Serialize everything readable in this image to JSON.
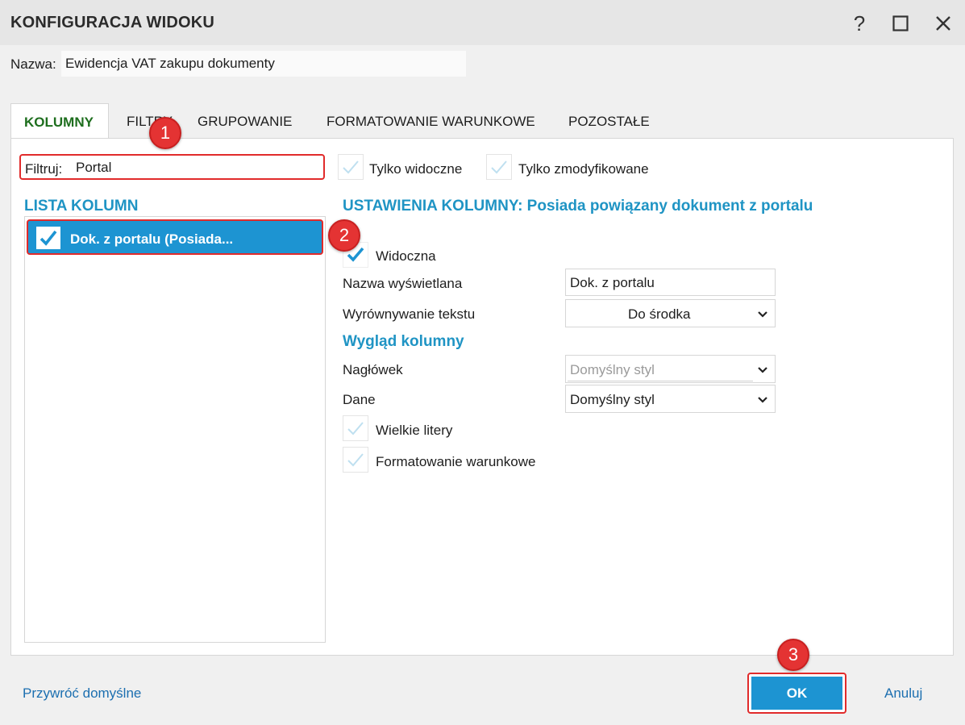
{
  "window": {
    "title": "KONFIGURACJA WIDOKU",
    "help_label": "?",
    "maximize_label": "☐",
    "close_label": "✕"
  },
  "name_field": {
    "label": "Nazwa:",
    "value": "Ewidencja VAT zakupu dokumenty"
  },
  "tabs": [
    {
      "label": "KOLUMNY",
      "active": true
    },
    {
      "label": "FILTRY",
      "active": false
    },
    {
      "label": "GRUPOWANIE",
      "active": false
    },
    {
      "label": "FORMATOWANIE WARUNKOWE",
      "active": false
    },
    {
      "label": "POZOSTAŁE",
      "active": false
    }
  ],
  "filter": {
    "label": "Filtruj:",
    "value": "Portal",
    "only_visible_label": "Tylko widoczne",
    "only_modified_label": "Tylko zmodyfikowane"
  },
  "column_list": {
    "title": "LISTA KOLUMN",
    "items": [
      {
        "label": "Dok. z portalu (Posiada...",
        "checked": true,
        "selected": true
      }
    ]
  },
  "column_settings": {
    "title": "USTAWIENIA KOLUMNY: Posiada powiązany dokument z portalu",
    "visible_label": "Widoczna",
    "display_name_label": "Nazwa wyświetlana",
    "display_name_value": "Dok. z portalu",
    "alignment_label": "Wyrównywanie tekstu",
    "alignment_value": "Do środka",
    "appearance_title": "Wygląd kolumny",
    "header_label": "Nagłówek",
    "header_value": "Domyślny styl",
    "data_label": "Dane",
    "data_value": "Domyślny styl",
    "uppercase_label": "Wielkie litery",
    "conditional_label": "Formatowanie warunkowe"
  },
  "badges": {
    "one": "1",
    "two": "2",
    "three": "3"
  },
  "footer": {
    "restore_label": "Przywróć domyślne",
    "ok_label": "OK",
    "cancel_label": "Anuluj"
  },
  "colors": {
    "accent": "#1d94d2",
    "section_title": "#1f94c4",
    "active_tab": "#1e6e1e",
    "highlight": "#e12b2b",
    "link": "#1c6fb0"
  }
}
